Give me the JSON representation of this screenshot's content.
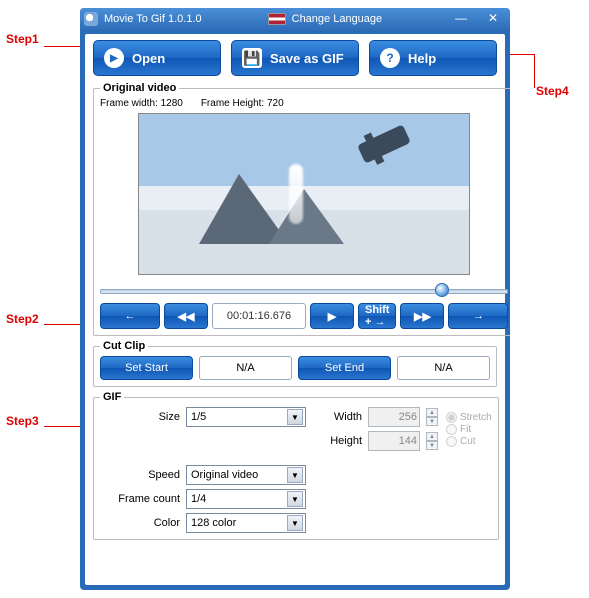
{
  "titlebar": {
    "app_title": "Movie To Gif 1.0.1.0",
    "lang_label": "Change Language"
  },
  "toolbar": {
    "open_label": "Open",
    "save_label": "Save as GIF",
    "help_label": "Help"
  },
  "original": {
    "legend": "Original video",
    "frame_width_label": "Frame width: 1280",
    "frame_height_label": "Frame Height: 720",
    "time": "00:01:16.676",
    "shift_label": "Shift + →"
  },
  "cutclip": {
    "legend": "Cut Clip",
    "set_start": "Set Start",
    "start_val": "N/A",
    "set_end": "Set End",
    "end_val": "N/A"
  },
  "gif": {
    "legend": "GIF",
    "size_label": "Size",
    "size_val": "1/5",
    "width_label": "Width",
    "width_val": "256",
    "height_label": "Height",
    "height_val": "144",
    "stretch": "Stretch",
    "fit": "Fit",
    "cut": "Cut",
    "speed_label": "Speed",
    "speed_val": "Original video",
    "framecount_label": "Frame count",
    "framecount_val": "1/4",
    "color_label": "Color",
    "color_val": "128 color"
  },
  "annotations": {
    "s1": "Step1",
    "s2": "Step2",
    "s3": "Step3",
    "s4": "Step4"
  }
}
